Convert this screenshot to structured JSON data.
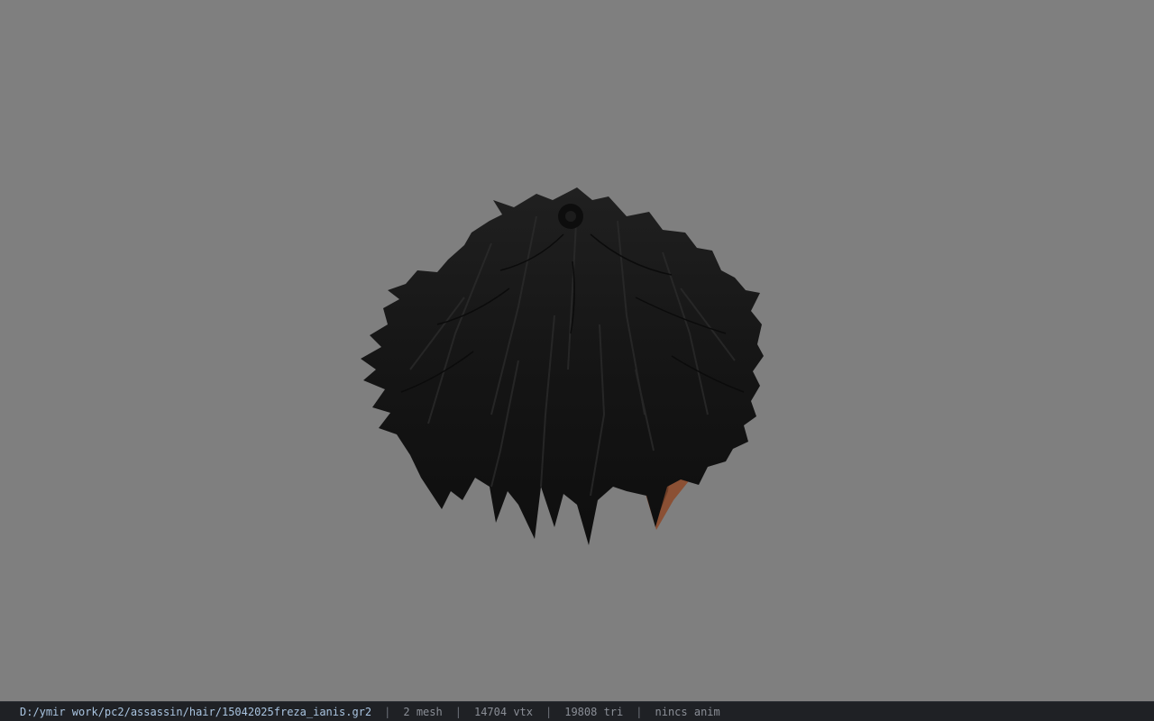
{
  "viewport": {
    "background_color": "#7f7f7f",
    "model": {
      "name": "hair-mesh",
      "hair_color": "#161616",
      "skin_color": "#8b5034"
    }
  },
  "statusbar": {
    "file_path": "D:/ymir work/pc2/assassin/hair/15042025freza_ianis.gr2",
    "separator": "|",
    "mesh_count": "2 mesh",
    "vertex_count": "14704 vtx",
    "triangle_count": "19808 tri",
    "anim_status": "nincs anim"
  }
}
